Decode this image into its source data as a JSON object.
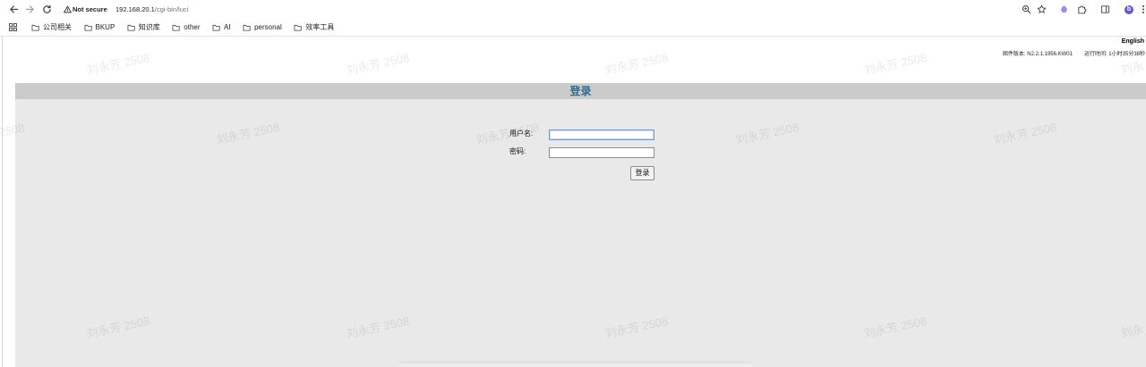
{
  "browser": {
    "security_label": "Not secure",
    "url_host": "192.168.20.1",
    "url_path": "/cgi-bin/luci",
    "profile_initial": "b",
    "toolbar_icons": [
      "arrow-left-icon",
      "arrow-right-icon",
      "reload-icon",
      "warning-icon",
      "zoom-icon",
      "star-icon",
      "extension-icon",
      "puzzle-icon",
      "side-panel-icon",
      "menu-dots-icon",
      "apps-grid-icon"
    ],
    "bookmarks": [
      {
        "label": "公司相关",
        "icon": "folder-icon"
      },
      {
        "label": "BKUP",
        "icon": "folder-icon"
      },
      {
        "label": "知识库",
        "icon": "folder-icon"
      },
      {
        "label": "other",
        "icon": "folder-icon"
      },
      {
        "label": "AI",
        "icon": "folder-icon"
      },
      {
        "label": "personal",
        "icon": "folder-icon"
      },
      {
        "label": "效率工具",
        "icon": "folder-icon"
      }
    ]
  },
  "page": {
    "language_link": "English",
    "firmware": "固件版本: N2.2.1.1956.KW01",
    "uptime": "运行时间: 1小时35分38秒",
    "title": "登录",
    "form": {
      "username_label": "用户名:",
      "username_value": "",
      "password_label": "密码:",
      "password_value": "",
      "submit_label": "登录"
    }
  },
  "watermark": {
    "text": "刘永芳 2508"
  },
  "colors": {
    "title": "#2c6e8e",
    "header_band": "#cbcbcb",
    "main_bg": "#e9e9e9",
    "focus_border": "#6c9bd6",
    "avatar": "#6557d6",
    "extension_icon": "#9b8cf2"
  }
}
